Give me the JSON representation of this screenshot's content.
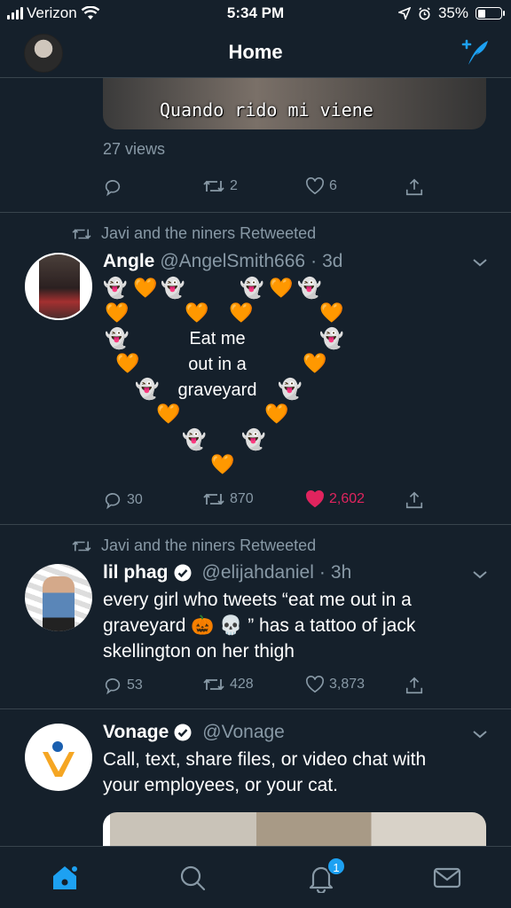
{
  "status_bar": {
    "carrier": "Verizon",
    "time": "5:34 PM",
    "battery": "35%",
    "battery_level": 0.35
  },
  "header": {
    "title": "Home"
  },
  "previous_tweet": {
    "media_caption": "Quando rido mi viene",
    "views": "27 views",
    "retweets": "2",
    "likes": "6"
  },
  "tweets": [
    {
      "retweeted_by": "Javi and the niners Retweeted",
      "name": "Angle",
      "handle": "@AngelSmith666",
      "time": "3d",
      "text_lines": [
        "Eat me",
        "out in a",
        "graveyard"
      ],
      "replies": "30",
      "retweets": "870",
      "likes": "2,602",
      "liked": true
    },
    {
      "retweeted_by": "Javi and the niners Retweeted",
      "name": "lil phag",
      "handle": "@elijahdaniel",
      "time": "3h",
      "verified": true,
      "text_line1": "every girl who tweets “eat me out in a",
      "text_line2a": "graveyard",
      "text_line2b": "” has a tattoo of jack",
      "text_line3": "skellington on her thigh",
      "emojis": [
        "🎃",
        "💀"
      ],
      "replies": "53",
      "retweets": "428",
      "likes": "3,873"
    },
    {
      "name": "Vonage",
      "handle": "@Vonage",
      "verified": true,
      "text_line1": "Call, text, share files, or video chat with",
      "text_line2": "your employees, or your cat."
    }
  ],
  "tab_bar": {
    "notifications_badge": "1"
  },
  "icons": [
    "signal-icon",
    "wifi-icon",
    "location-icon",
    "alarm-icon",
    "battery-icon",
    "compose-icon",
    "reply-icon",
    "retweet-icon",
    "like-icon",
    "share-icon",
    "chevron-down-icon",
    "verified-icon",
    "home-icon",
    "search-icon",
    "notifications-icon",
    "messages-icon"
  ],
  "colors": {
    "background": "#15202b",
    "accent": "#1da1f2",
    "muted": "#8899a6",
    "like": "#e0245e",
    "divider": "#38444d"
  }
}
